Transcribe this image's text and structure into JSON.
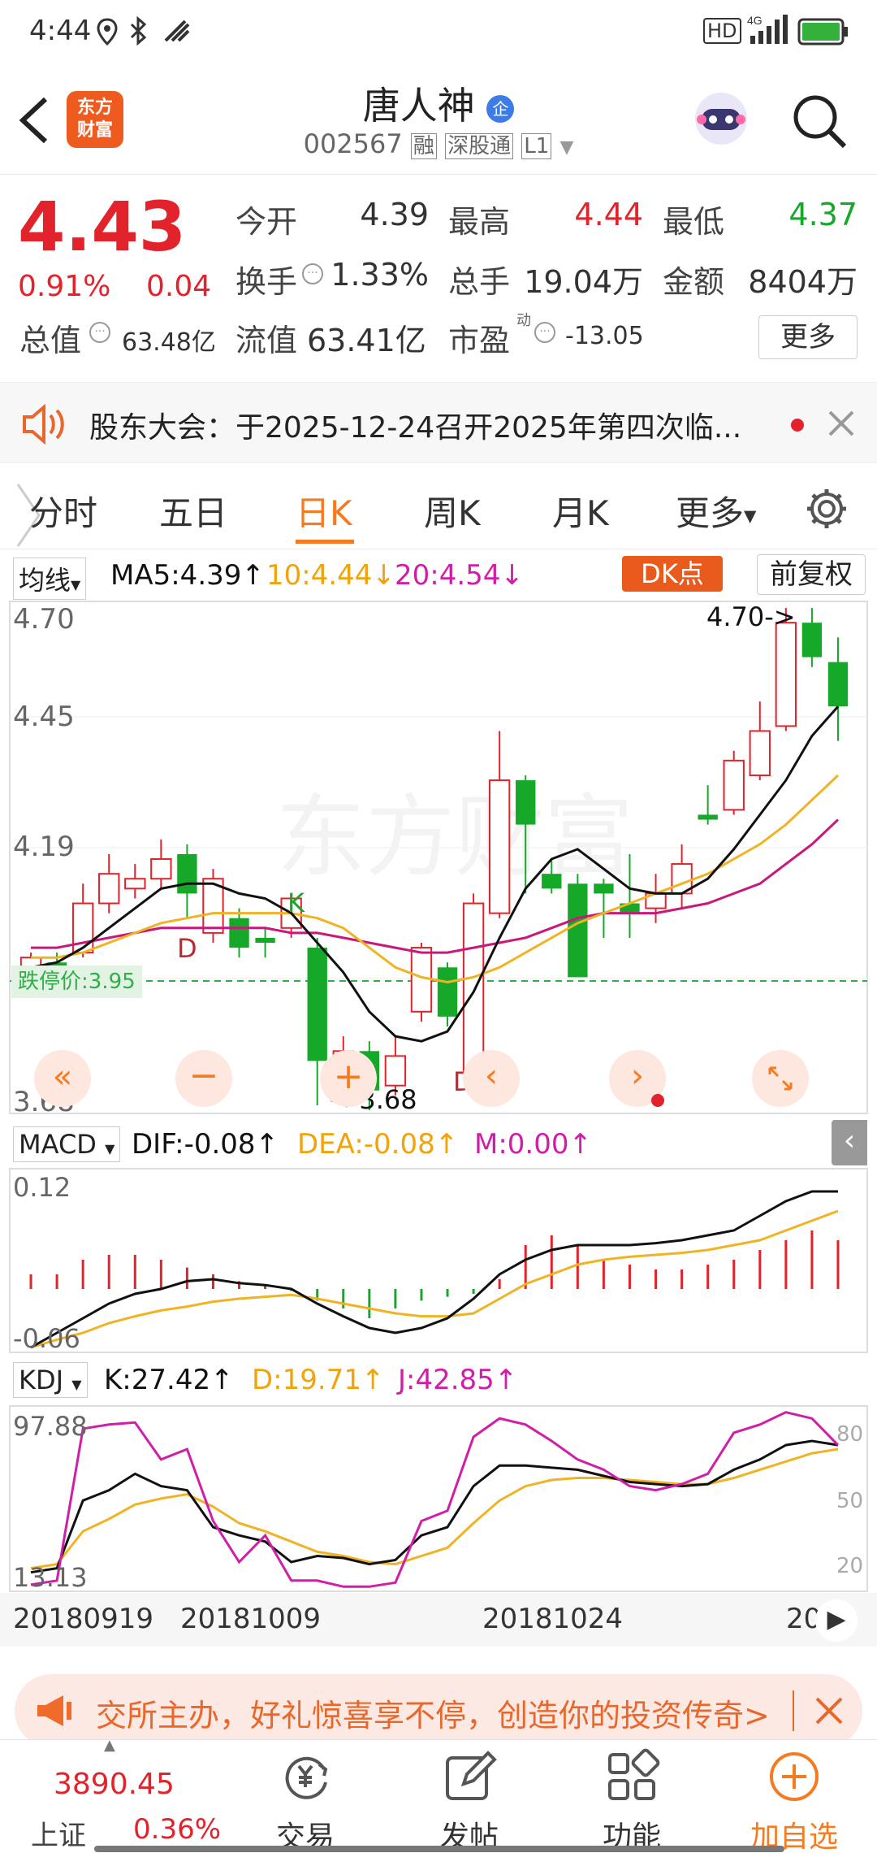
{
  "status_bar": {
    "time": "4:44",
    "network": "HD",
    "signal_label": "4G"
  },
  "header": {
    "logo_text": "东方\n财富",
    "stock_name": "唐人神",
    "stock_badge": "企",
    "stock_code": "002567",
    "tag_margin": "融",
    "tag_connect": "深股通",
    "tag_level": "L1"
  },
  "quote": {
    "price": "4.43",
    "change_pct": "0.91%",
    "change_abs": "0.04",
    "open_label": "今开",
    "open_value": "4.39",
    "high_label": "最高",
    "high_value": "4.44",
    "low_label": "最低",
    "low_value": "4.37",
    "turnover_label": "换手",
    "turnover_value": "1.33%",
    "volume_label": "总手",
    "volume_value": "19.04万",
    "amount_label": "金额",
    "amount_value": "8404万",
    "mktcap_label": "总值",
    "mktcap_value": "63.48亿",
    "float_label": "流值",
    "float_value": "63.41亿",
    "pe_label": "市盈",
    "pe_sup": "动",
    "pe_value": "-13.05",
    "more_button": "更多"
  },
  "notice": {
    "text": "股东大会：于2025-12-24召开2025年第四次临..."
  },
  "tabs": [
    {
      "label": "分时"
    },
    {
      "label": "五日"
    },
    {
      "label": "日K"
    },
    {
      "label": "周K"
    },
    {
      "label": "月K"
    },
    {
      "label": "更多"
    }
  ],
  "ma_row": {
    "selector": "均线",
    "ma5": "MA5:4.39",
    "ma10": "10:4.44",
    "ma20": "20:4.54",
    "dk_button": "DK点",
    "adjust_button": "前复权"
  },
  "chart_labels": {
    "y_top": "4.70",
    "y_mid1": "4.45",
    "y_mid2": "4.19",
    "y_bottom": "3.68",
    "high_marker": "4.70->",
    "low_marker": "<-3.68",
    "limit_down": "跌停价:3.95",
    "k_marker": "K",
    "d_marker1": "D",
    "d_marker2": "D"
  },
  "macd_row": {
    "selector": "MACD",
    "dif": "DIF:-0.08",
    "dea": "DEA:-0.08",
    "m": "M:0.00",
    "y_top": "0.12",
    "y_bottom": "-0.06"
  },
  "kdj_row": {
    "selector": "KDJ",
    "k": "K:27.42",
    "d": "D:19.71",
    "j": "J:42.85",
    "y_top": "97.88",
    "y_bottom": "13.13",
    "r80": "80",
    "r50": "50",
    "r20": "20"
  },
  "x_dates": {
    "d1": "20180919",
    "d2": "20181009",
    "d3": "20181024",
    "d4": "20"
  },
  "banner": {
    "text": "交所主办，好礼惊喜享不停，创造你的投资传奇>"
  },
  "bottom_nav": {
    "index_value": "3890.45",
    "index_name": "上证",
    "index_change": "0.36%",
    "trade": "交易",
    "post": "发帖",
    "functions": "功能",
    "add_watch": "加自选"
  },
  "colors": {
    "up": "#e2232b",
    "down": "#16a829",
    "ma5": "#111111",
    "ma10": "#f0b323",
    "ma20": "#c8187c",
    "accent": "#f47b20"
  },
  "chart_data": {
    "type": "candlestick",
    "y_range": [
      3.68,
      4.7
    ],
    "candles": [
      {
        "o": 3.95,
        "c": 3.99,
        "h": 4.0,
        "l": 3.93
      },
      {
        "o": 3.98,
        "c": 3.97,
        "h": 4.0,
        "l": 3.95
      },
      {
        "o": 4.0,
        "c": 4.1,
        "h": 4.14,
        "l": 3.99
      },
      {
        "o": 4.1,
        "c": 4.16,
        "h": 4.2,
        "l": 4.08
      },
      {
        "o": 4.13,
        "c": 4.15,
        "h": 4.18,
        "l": 4.11
      },
      {
        "o": 4.15,
        "c": 4.19,
        "h": 4.23,
        "l": 4.13
      },
      {
        "o": 4.2,
        "c": 4.12,
        "h": 4.22,
        "l": 4.07
      },
      {
        "o": 4.04,
        "c": 4.15,
        "h": 4.17,
        "l": 4.02
      },
      {
        "o": 4.07,
        "c": 4.01,
        "h": 4.09,
        "l": 3.99
      },
      {
        "o": 4.03,
        "c": 4.02,
        "h": 4.05,
        "l": 3.99
      },
      {
        "o": 4.05,
        "c": 4.11,
        "h": 4.12,
        "l": 4.03
      },
      {
        "o": 4.01,
        "c": 3.78,
        "h": 4.03,
        "l": 3.69
      },
      {
        "o": 3.74,
        "c": 3.8,
        "h": 3.83,
        "l": 3.7
      },
      {
        "o": 3.8,
        "c": 3.72,
        "h": 3.82,
        "l": 3.68
      },
      {
        "o": 3.73,
        "c": 3.79,
        "h": 3.83,
        "l": 3.71
      },
      {
        "o": 3.88,
        "c": 4.01,
        "h": 4.02,
        "l": 3.86
      },
      {
        "o": 3.97,
        "c": 3.87,
        "h": 3.98,
        "l": 3.85
      },
      {
        "o": 3.76,
        "c": 4.1,
        "h": 4.12,
        "l": 3.73
      },
      {
        "o": 4.08,
        "c": 4.35,
        "h": 4.45,
        "l": 4.07
      },
      {
        "o": 4.35,
        "c": 4.26,
        "h": 4.36,
        "l": 4.12
      },
      {
        "o": 4.16,
        "c": 4.13,
        "h": 4.19,
        "l": 4.12
      },
      {
        "o": 4.14,
        "c": 3.95,
        "h": 4.16,
        "l": 3.95
      },
      {
        "o": 4.14,
        "c": 4.12,
        "h": 4.15,
        "l": 4.03
      },
      {
        "o": 4.1,
        "c": 4.08,
        "h": 4.2,
        "l": 4.03
      },
      {
        "o": 4.09,
        "c": 4.12,
        "h": 4.16,
        "l": 4.06
      },
      {
        "o": 4.12,
        "c": 4.18,
        "h": 4.22,
        "l": 4.09
      },
      {
        "o": 4.28,
        "c": 4.27,
        "h": 4.34,
        "l": 4.26
      },
      {
        "o": 4.29,
        "c": 4.39,
        "h": 4.41,
        "l": 4.28
      },
      {
        "o": 4.36,
        "c": 4.45,
        "h": 4.51,
        "l": 4.35
      },
      {
        "o": 4.46,
        "c": 4.67,
        "h": 4.7,
        "l": 4.45
      },
      {
        "o": 4.67,
        "c": 4.6,
        "h": 4.7,
        "l": 4.58
      },
      {
        "o": 4.59,
        "c": 4.5,
        "h": 4.64,
        "l": 4.43
      }
    ],
    "ma5": [
      3.97,
      3.98,
      4.01,
      4.05,
      4.09,
      4.13,
      4.14,
      4.14,
      4.12,
      4.11,
      4.08,
      4.02,
      3.96,
      3.88,
      3.83,
      3.82,
      3.84,
      3.92,
      4.03,
      4.13,
      4.19,
      4.21,
      4.17,
      4.13,
      4.12,
      4.12,
      4.15,
      4.21,
      4.28,
      4.35,
      4.44,
      4.5
    ],
    "ma10": [
      3.99,
      3.99,
      4.0,
      4.02,
      4.04,
      4.06,
      4.07,
      4.08,
      4.08,
      4.08,
      4.08,
      4.07,
      4.05,
      4.01,
      3.97,
      3.95,
      3.94,
      3.95,
      3.97,
      4.0,
      4.03,
      4.06,
      4.08,
      4.1,
      4.12,
      4.14,
      4.16,
      4.19,
      4.22,
      4.26,
      4.31,
      4.36
    ],
    "ma20": [
      4.01,
      4.01,
      4.02,
      4.03,
      4.04,
      4.05,
      4.05,
      4.05,
      4.05,
      4.05,
      4.04,
      4.04,
      4.03,
      4.02,
      4.01,
      4.0,
      4.0,
      4.01,
      4.02,
      4.03,
      4.05,
      4.07,
      4.08,
      4.08,
      4.08,
      4.09,
      4.1,
      4.12,
      4.14,
      4.18,
      4.22,
      4.27
    ],
    "macd_range": [
      -0.06,
      0.12
    ],
    "macd_hist": [
      0.015,
      0.015,
      0.03,
      0.035,
      0.035,
      0.03,
      0.022,
      0.015,
      0.008,
      0.005,
      -0.002,
      -0.012,
      -0.02,
      -0.03,
      -0.02,
      -0.012,
      -0.008,
      -0.005,
      0.01,
      0.045,
      0.055,
      0.045,
      0.03,
      0.025,
      0.02,
      0.02,
      0.025,
      0.03,
      0.04,
      0.05,
      0.06,
      0.05
    ],
    "dif": [
      -0.06,
      -0.045,
      -0.03,
      -0.015,
      -0.005,
      0.0,
      0.008,
      0.01,
      0.006,
      0.004,
      0.0,
      -0.015,
      -0.028,
      -0.04,
      -0.045,
      -0.04,
      -0.03,
      -0.01,
      0.015,
      0.03,
      0.04,
      0.045,
      0.045,
      0.045,
      0.047,
      0.05,
      0.055,
      0.06,
      0.075,
      0.09,
      0.1,
      0.1
    ],
    "dea": [
      -0.06,
      -0.052,
      -0.045,
      -0.035,
      -0.028,
      -0.022,
      -0.018,
      -0.013,
      -0.01,
      -0.008,
      -0.006,
      -0.01,
      -0.015,
      -0.02,
      -0.025,
      -0.028,
      -0.028,
      -0.025,
      -0.01,
      0.005,
      0.015,
      0.025,
      0.03,
      0.033,
      0.035,
      0.037,
      0.04,
      0.045,
      0.05,
      0.06,
      0.07,
      0.08
    ],
    "kdj_range": [
      13.13,
      97.88
    ],
    "kdj_k": [
      20,
      22,
      55,
      60,
      68,
      62,
      60,
      42,
      38,
      35,
      25,
      28,
      27,
      24,
      26,
      38,
      42,
      62,
      72,
      72,
      71,
      70,
      67,
      64,
      63,
      62,
      63,
      70,
      75,
      82,
      84,
      82
    ],
    "kdj_d": [
      22,
      24,
      40,
      46,
      53,
      56,
      58,
      52,
      44,
      40,
      35,
      30,
      28,
      25,
      24,
      28,
      32,
      44,
      55,
      62,
      65,
      66,
      66,
      65,
      64,
      63,
      63,
      66,
      70,
      74,
      78,
      80
    ],
    "kdj_j": [
      14,
      16,
      90,
      92,
      93,
      75,
      80,
      45,
      25,
      38,
      16,
      16,
      13,
      13,
      15,
      45,
      50,
      86,
      95,
      92,
      84,
      75,
      70,
      62,
      60,
      63,
      68,
      88,
      92,
      98,
      95,
      82
    ],
    "x_dates": [
      "20180919",
      "20181009",
      "20181024"
    ]
  }
}
